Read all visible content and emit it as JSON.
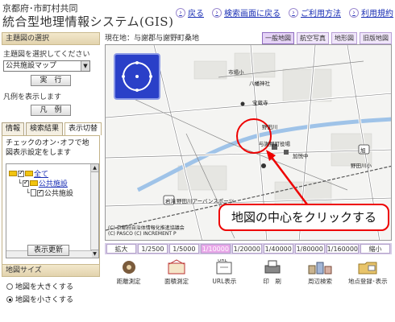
{
  "header": {
    "line1": "京都府･市町村共同",
    "line2": "統合型地理情報システム(GIS)",
    "links": [
      "戻る",
      "検索画面に戻る",
      "ご利用方法",
      "利用規約"
    ]
  },
  "sidebar": {
    "theme_title": "主題図の選択",
    "theme_label": "主題図を選択してください",
    "theme_select_value": "公共施設マップ",
    "run_button": "実　行",
    "legend_label": "凡例を表示します",
    "legend_button": "凡　例",
    "tabs": [
      "情報",
      "検索結果",
      "表示切替"
    ],
    "active_tab": "表示切替",
    "tab_desc": "チェックのオン･オフで地図表示設定をします",
    "tree": {
      "root": "全て",
      "group": "公共施設",
      "item": "公共施設"
    },
    "refresh_button": "表示更新",
    "size_title": "地図サイズ",
    "size_options": [
      "地図を大きくする",
      "地図を小さくする"
    ],
    "size_selected": "地図を小さくする"
  },
  "location": "現在地：与謝郡与謝野町桑地",
  "map_tabs": [
    "一般地図",
    "航空写真",
    "地形図",
    "旧版地図"
  ],
  "map_tab_active": "一般地図",
  "map": {
    "copyright": [
      "(C) 京都府自治体情報化推進協議会",
      "(C) PASCO (C) INCREMENT P"
    ],
    "callout": "地図の中心をクリックする",
    "labels": [
      "市場小",
      "八幡神社",
      "宝蔵寺",
      "野田川",
      "与謝野町役場",
      "加悦中",
      "旭",
      "野田川小",
      "岩滝",
      "野田川アーバンスポーツ"
    ]
  },
  "scale_buttons": [
    "拡大",
    "1/2500",
    "1/5000",
    "1/10000",
    "1/20000",
    "1/40000",
    "1/80000",
    "1/160000",
    "縮小"
  ],
  "scale_active": "1/10000",
  "tools": [
    "距離測定",
    "面積測定",
    "URL表示",
    "印　刷",
    "周辺検索",
    "地点登録･表示"
  ]
}
